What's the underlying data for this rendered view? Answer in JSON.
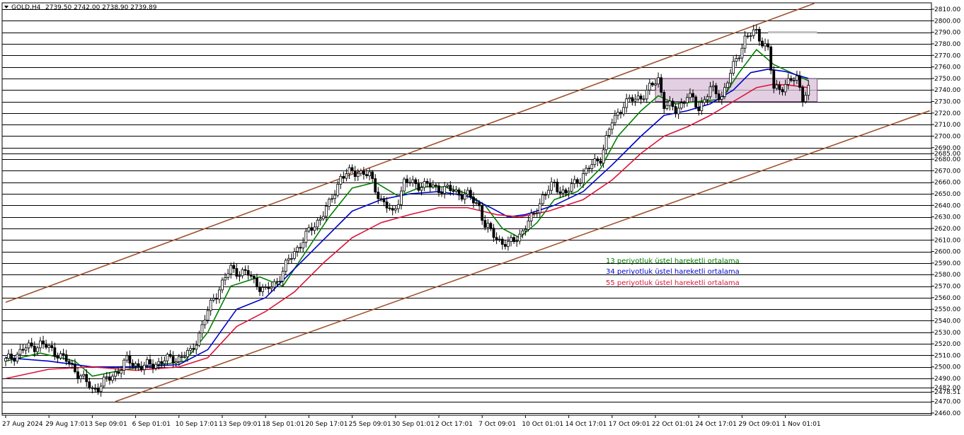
{
  "header": {
    "symbol": "GOLD,H4",
    "ohlc": "2739.50 2742.00 2738.90 2739.89"
  },
  "colors": {
    "background": "#ffffff",
    "grid": "#000000",
    "candle": "#000000",
    "channel": "#a0522d",
    "box_fill": "#d8bfd8",
    "box_edge": "#8b5a8b",
    "ema13": "#008000",
    "ema34": "#0000cd",
    "ema55": "#dc143c",
    "level_marker": "#c0c0c0"
  },
  "chart_data": {
    "type": "candlestick",
    "symbol": "GOLD",
    "timeframe": "H4",
    "ylim": [
      2460,
      2813
    ],
    "y_ticks": [
      "2810.00",
      "2800.00",
      "2790.00",
      "2780.00",
      "2770.00",
      "2760.00",
      "2750.00",
      "2740.00",
      "2730.00",
      "2720.00",
      "2710.00",
      "2700.00",
      "2690.00",
      "2685.00",
      "2680.00",
      "2670.00",
      "2660.00",
      "2650.00",
      "2640.00",
      "2630.00",
      "2620.00",
      "2610.00",
      "2600.00",
      "2590.00",
      "2580.00",
      "2570.00",
      "2560.00",
      "2550.00",
      "2540.00",
      "2530.00",
      "2520.00",
      "2510.00",
      "2500.00",
      "2490.00",
      "2482.00",
      "2478.51",
      "2470.00",
      "2460.00"
    ],
    "horizontal_levels": [
      2810,
      2800,
      2790,
      2780,
      2770,
      2760,
      2750,
      2740,
      2730,
      2720,
      2710,
      2700,
      2690,
      2685,
      2680,
      2670,
      2660,
      2650,
      2640,
      2630,
      2620,
      2610,
      2600,
      2590,
      2580,
      2570,
      2560,
      2550,
      2540,
      2530,
      2520,
      2510,
      2500,
      2490,
      2482,
      2478.51,
      2470,
      2460
    ],
    "x_ticks": [
      {
        "label": "27 Aug 2024",
        "index": 0
      },
      {
        "label": "29 Aug 17:01",
        "index": 15
      },
      {
        "label": "3 Sep 09:01",
        "index": 30
      },
      {
        "label": "6 Sep 01:01",
        "index": 45
      },
      {
        "label": "10 Sep 17:01",
        "index": 60
      },
      {
        "label": "13 Sep 09:01",
        "index": 75
      },
      {
        "label": "18 Sep 01:01",
        "index": 90
      },
      {
        "label": "20 Sep 17:01",
        "index": 105
      },
      {
        "label": "25 Sep 09:01",
        "index": 120
      },
      {
        "label": "30 Sep 01:01",
        "index": 135
      },
      {
        "label": "2 Oct 17:01",
        "index": 150
      },
      {
        "label": "7 Oct 09:01",
        "index": 165
      },
      {
        "label": "10 Oct 01:01",
        "index": 180
      },
      {
        "label": "14 Oct 17:01",
        "index": 195
      },
      {
        "label": "17 Oct 09:01",
        "index": 210
      },
      {
        "label": "22 Oct 01:01",
        "index": 225
      },
      {
        "label": "24 Oct 17:01",
        "index": 240
      },
      {
        "label": "29 Oct 09:01",
        "index": 255
      },
      {
        "label": "1 Nov 01:01",
        "index": 270
      }
    ],
    "close_path": [
      [
        0,
        2505
      ],
      [
        6,
        2515
      ],
      [
        12,
        2520
      ],
      [
        18,
        2512
      ],
      [
        24,
        2498
      ],
      [
        30,
        2480
      ],
      [
        36,
        2490
      ],
      [
        42,
        2505
      ],
      [
        48,
        2500
      ],
      [
        54,
        2505
      ],
      [
        60,
        2508
      ],
      [
        64,
        2512
      ],
      [
        68,
        2535
      ],
      [
        72,
        2560
      ],
      [
        78,
        2585
      ],
      [
        84,
        2580
      ],
      [
        90,
        2565
      ],
      [
        94,
        2575
      ],
      [
        100,
        2600
      ],
      [
        106,
        2620
      ],
      [
        112,
        2640
      ],
      [
        116,
        2665
      ],
      [
        122,
        2670
      ],
      [
        126,
        2665
      ],
      [
        130,
        2645
      ],
      [
        134,
        2632
      ],
      [
        138,
        2660
      ],
      [
        144,
        2658
      ],
      [
        150,
        2655
      ],
      [
        156,
        2652
      ],
      [
        160,
        2648
      ],
      [
        164,
        2640
      ],
      [
        166,
        2622
      ],
      [
        170,
        2612
      ],
      [
        174,
        2605
      ],
      [
        178,
        2615
      ],
      [
        182,
        2628
      ],
      [
        186,
        2648
      ],
      [
        190,
        2658
      ],
      [
        194,
        2650
      ],
      [
        198,
        2662
      ],
      [
        202,
        2672
      ],
      [
        206,
        2682
      ],
      [
        210,
        2712
      ],
      [
        214,
        2728
      ],
      [
        218,
        2732
      ],
      [
        222,
        2738
      ],
      [
        226,
        2750
      ],
      [
        228,
        2728
      ],
      [
        232,
        2722
      ],
      [
        236,
        2735
      ],
      [
        240,
        2725
      ],
      [
        244,
        2740
      ],
      [
        248,
        2735
      ],
      [
        252,
        2760
      ],
      [
        256,
        2785
      ],
      [
        260,
        2790
      ],
      [
        264,
        2775
      ],
      [
        266,
        2740
      ],
      [
        270,
        2745
      ],
      [
        274,
        2750
      ],
      [
        276,
        2735
      ],
      [
        278,
        2740
      ]
    ],
    "series": [
      {
        "name": "13 periyotluk üstel hareketli ortalama",
        "type": "line",
        "period": 13,
        "points": [
          [
            0,
            2505
          ],
          [
            12,
            2512
          ],
          [
            24,
            2505
          ],
          [
            30,
            2492
          ],
          [
            42,
            2498
          ],
          [
            54,
            2502
          ],
          [
            62,
            2505
          ],
          [
            70,
            2530
          ],
          [
            78,
            2570
          ],
          [
            88,
            2578
          ],
          [
            96,
            2570
          ],
          [
            104,
            2600
          ],
          [
            112,
            2630
          ],
          [
            120,
            2655
          ],
          [
            128,
            2660
          ],
          [
            136,
            2648
          ],
          [
            144,
            2656
          ],
          [
            152,
            2656
          ],
          [
            160,
            2650
          ],
          [
            166,
            2640
          ],
          [
            172,
            2620
          ],
          [
            178,
            2612
          ],
          [
            184,
            2625
          ],
          [
            190,
            2645
          ],
          [
            198,
            2652
          ],
          [
            206,
            2672
          ],
          [
            212,
            2700
          ],
          [
            220,
            2722
          ],
          [
            226,
            2735
          ],
          [
            232,
            2728
          ],
          [
            240,
            2730
          ],
          [
            248,
            2732
          ],
          [
            254,
            2755
          ],
          [
            260,
            2775
          ],
          [
            266,
            2762
          ],
          [
            272,
            2755
          ],
          [
            278,
            2748
          ]
        ]
      },
      {
        "name": "34 periyotluk üstel hareketli ortalama",
        "type": "line",
        "period": 34,
        "points": [
          [
            0,
            2508
          ],
          [
            15,
            2505
          ],
          [
            30,
            2500
          ],
          [
            45,
            2500
          ],
          [
            60,
            2502
          ],
          [
            70,
            2515
          ],
          [
            80,
            2550
          ],
          [
            90,
            2560
          ],
          [
            100,
            2585
          ],
          [
            110,
            2610
          ],
          [
            120,
            2635
          ],
          [
            130,
            2645
          ],
          [
            140,
            2650
          ],
          [
            150,
            2652
          ],
          [
            160,
            2648
          ],
          [
            168,
            2638
          ],
          [
            174,
            2630
          ],
          [
            180,
            2632
          ],
          [
            190,
            2640
          ],
          [
            200,
            2652
          ],
          [
            210,
            2675
          ],
          [
            220,
            2700
          ],
          [
            228,
            2718
          ],
          [
            236,
            2722
          ],
          [
            244,
            2728
          ],
          [
            252,
            2740
          ],
          [
            258,
            2755
          ],
          [
            264,
            2758
          ],
          [
            270,
            2756
          ],
          [
            278,
            2750
          ]
        ]
      },
      {
        "name": "55 periyotluk üstel hareketli ortalama",
        "type": "line",
        "period": 55,
        "points": [
          [
            0,
            2490
          ],
          [
            15,
            2498
          ],
          [
            30,
            2500
          ],
          [
            45,
            2497
          ],
          [
            60,
            2500
          ],
          [
            70,
            2508
          ],
          [
            80,
            2535
          ],
          [
            90,
            2548
          ],
          [
            100,
            2565
          ],
          [
            110,
            2590
          ],
          [
            120,
            2612
          ],
          [
            130,
            2625
          ],
          [
            140,
            2632
          ],
          [
            150,
            2638
          ],
          [
            160,
            2638
          ],
          [
            170,
            2632
          ],
          [
            178,
            2630
          ],
          [
            188,
            2635
          ],
          [
            200,
            2645
          ],
          [
            210,
            2662
          ],
          [
            220,
            2685
          ],
          [
            228,
            2700
          ],
          [
            236,
            2708
          ],
          [
            244,
            2718
          ],
          [
            252,
            2730
          ],
          [
            260,
            2742
          ],
          [
            266,
            2745
          ],
          [
            272,
            2744
          ],
          [
            278,
            2742
          ]
        ]
      }
    ],
    "channel_lines": [
      {
        "from": [
          0,
          2556
        ],
        "to": [
          280,
          2815
        ]
      },
      {
        "from": [
          38,
          2470
        ],
        "to": [
          320,
          2722
        ]
      }
    ],
    "box": {
      "x_from": 225,
      "x_to": 281,
      "y_from": 2730,
      "y_to": 2750
    },
    "marker_level": {
      "x_from": 264,
      "x_to": 281,
      "y": 2790
    },
    "x_count": 322,
    "grid": "horizontal",
    "legend_position": "center"
  }
}
